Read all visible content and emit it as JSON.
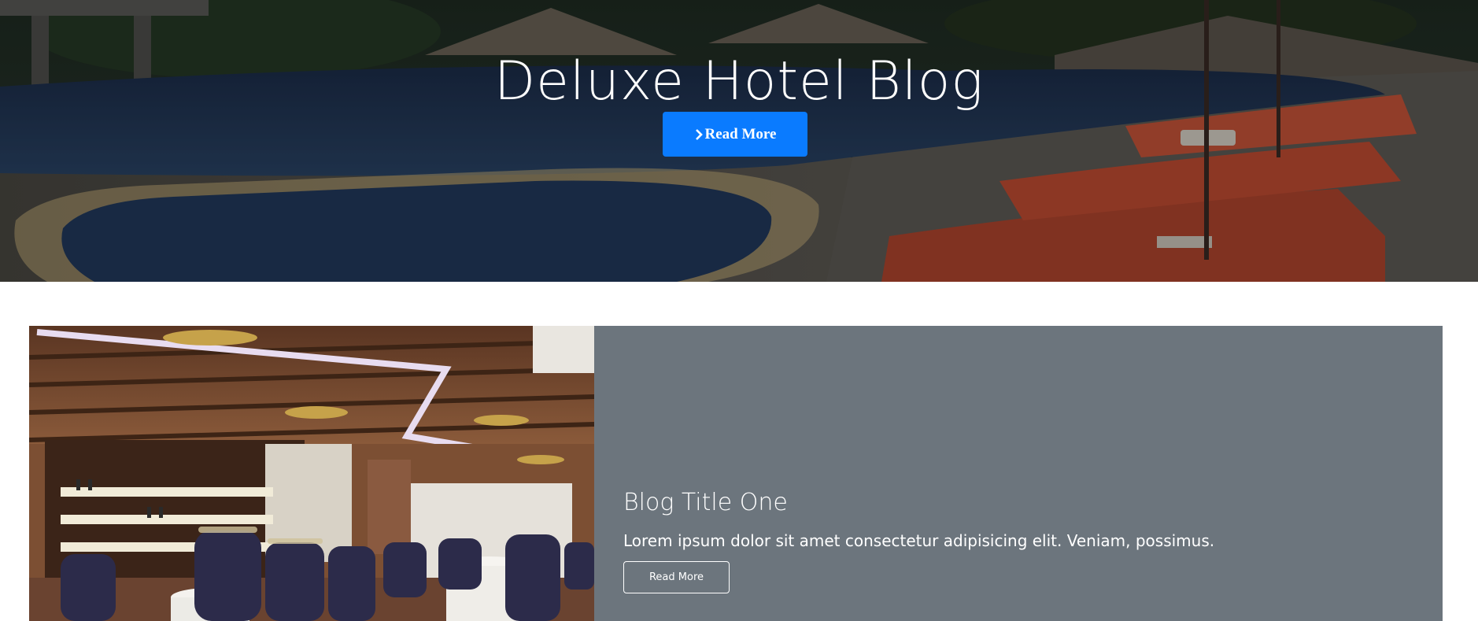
{
  "hero": {
    "title": "Deluxe Hotel Blog",
    "button_label": "Read More",
    "button_icon": "chevron-right-icon",
    "button_color": "#0a7bff"
  },
  "posts": [
    {
      "title": "Blog Title One",
      "excerpt": "Lorem ipsum dolor sit amet consectetur adipisicing elit. Veniam, possimus.",
      "button_label": "Read More",
      "card_color": "#6c757d"
    }
  ]
}
